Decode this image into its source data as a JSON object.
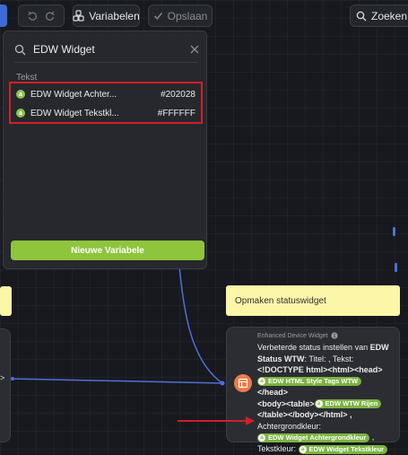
{
  "toolbar": {
    "variables_label": "Variabelen",
    "save_label": "Opslaan",
    "search_label": "Zoeken..."
  },
  "variable_search": {
    "query": "EDW Widget",
    "section_label": "Tekst",
    "items": [
      {
        "name": "EDW Widget Achter...",
        "value": "#202028",
        "badge": "a"
      },
      {
        "name": "EDW Widget Tekstkl...",
        "value": "#FFFFFF",
        "badge": "a"
      }
    ],
    "new_variable_label": "Nieuwe Variabele"
  },
  "canvas": {
    "note_right": "Opmaken statuswidget",
    "left_port_label": "",
    "widget_node": {
      "header": "Enhanced Device Widget",
      "line1": "Verbeterde status instellen van",
      "line1_bold": "EDW Status WTW",
      "line2": ": Titel:  , Tekst:",
      "line3": "<!DOCTYPE html><html><head>",
      "chip1": "EDW HTML Style Tags WTW",
      "line4": "</head>",
      "line5": "<body><table>",
      "chip2": "EDW WTW Rijen",
      "line6": "</table></body></html> ,",
      "line7": "Achtergrondkleur:",
      "chip3": "EDW Widget Achtergrondkleur",
      "line8": " ,",
      "line9": "Tekstkleur:",
      "chip4": "EDW Widget Tekstkleur",
      "chip_badge": "a"
    }
  },
  "colors": {
    "accent_green": "#8fc43d",
    "highlight_red": "#d21f26",
    "note_yellow": "#fbf6a8",
    "node_icon_orange": "#f07a45",
    "connector_blue": "#4f6fd6"
  }
}
